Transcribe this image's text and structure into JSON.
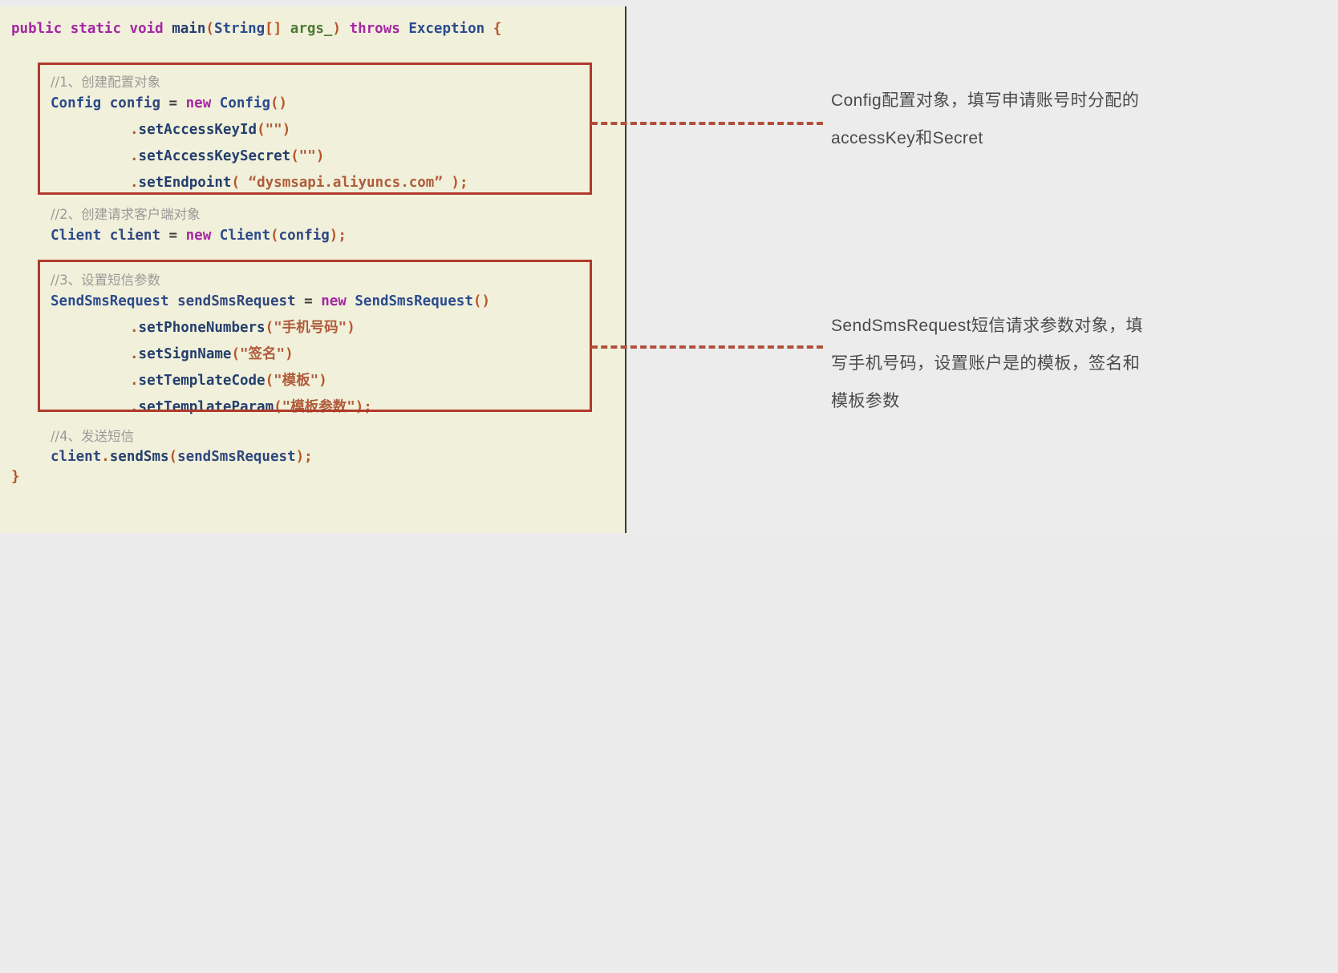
{
  "theme": {
    "code_bg": "#f1f0da",
    "page_bg": "#ececec",
    "highlight_box_color": "#b03a2c",
    "connector_color": "#b0503c",
    "annotation_text_color": "#4a4a4a",
    "panel_border": "#3a3a3a"
  },
  "code": {
    "language": "Java",
    "lines": [
      {
        "id": "line-signature",
        "text": "public static void main(String[] args_) throws Exception {"
      },
      {
        "id": "comment-1",
        "text": "//1、创建配置对象"
      },
      {
        "id": "line-config-new",
        "text": "Config config = new Config()"
      },
      {
        "id": "line-accesskeyid",
        "text": ".setAccessKeyId(\"\")"
      },
      {
        "id": "line-accesskeysecret",
        "text": ".setAccessKeySecret(\"\")"
      },
      {
        "id": "line-endpoint",
        "text": ".setEndpoint( “dysmsapi.aliyuncs.com” );"
      },
      {
        "id": "comment-2",
        "text": "//2、创建请求客户端对象"
      },
      {
        "id": "line-client-new",
        "text": "Client client = new Client(config);"
      },
      {
        "id": "comment-3",
        "text": "//3、设置短信参数"
      },
      {
        "id": "line-request-new",
        "text": "SendSmsRequest sendSmsRequest = new SendSmsRequest()"
      },
      {
        "id": "line-phonenumbers",
        "text": ".setPhoneNumbers(\"手机号码\")"
      },
      {
        "id": "line-signname",
        "text": ".setSignName(\"签名\")"
      },
      {
        "id": "line-templatecode",
        "text": ".setTemplateCode(\"模板\")"
      },
      {
        "id": "line-templateparam",
        "text": ".setTemplateParam(\"模板参数\");"
      },
      {
        "id": "comment-4",
        "text": "//4、发送短信"
      },
      {
        "id": "line-sendsms",
        "text": "client.sendSms(sendSmsRequest);"
      },
      {
        "id": "line-close-brace",
        "text": "}"
      }
    ],
    "tokens": {
      "kw_public": "public",
      "kw_static": "static",
      "kw_void": "void",
      "fn_main": "main",
      "paren_open": "(",
      "type_string": "String",
      "brackets": "[]",
      "arg_name": "args_",
      "paren_close": ")",
      "kw_throws": "throws",
      "type_exception": "Exception",
      "brace_open": "{",
      "brace_close": "}",
      "kw_new": "new",
      "eq": "=",
      "semi": ";",
      "dot": ".",
      "type_config": "Config",
      "ident_config": "config",
      "type_client": "Client",
      "ident_client": "client",
      "type_sendsmsrequest": "SendSmsRequest",
      "ident_sendsmsrequest": "sendSmsRequest",
      "m_setAccessKeyId": "setAccessKeyId",
      "m_setAccessKeySecret": "setAccessKeySecret",
      "m_setEndpoint": "setEndpoint",
      "m_setPhoneNumbers": "setPhoneNumbers",
      "m_setSignName": "setSignName",
      "m_setTemplateCode": "setTemplateCode",
      "m_setTemplateParam": "setTemplateParam",
      "m_sendSms": "sendSms",
      "s_empty": "\"\"",
      "s_endpoint": "“dysmsapi.aliyuncs.com”",
      "s_phone": "\"手机号码\"",
      "s_sign": "\"签名\"",
      "s_template": "\"模板\"",
      "s_templateparam": "\"模板参数\"",
      "comment_1": "//1、创建配置对象",
      "comment_2": "//2、创建请求客户端对象",
      "comment_3": "//3、设置短信参数",
      "comment_4": "//4、发送短信"
    }
  },
  "annotations": [
    {
      "id": "annotation-config",
      "target": "config-highlight-box",
      "lines": [
        "Config配置对象，填写申请账号时分配的",
        "accessKey和Secret"
      ]
    },
    {
      "id": "annotation-sendsmsrequest",
      "target": "sendsmsrequest-highlight-box",
      "lines": [
        "SendSmsRequest短信请求参数对象，填",
        "写手机号码，设置账户是的模板，签名和",
        "模板参数"
      ]
    }
  ]
}
